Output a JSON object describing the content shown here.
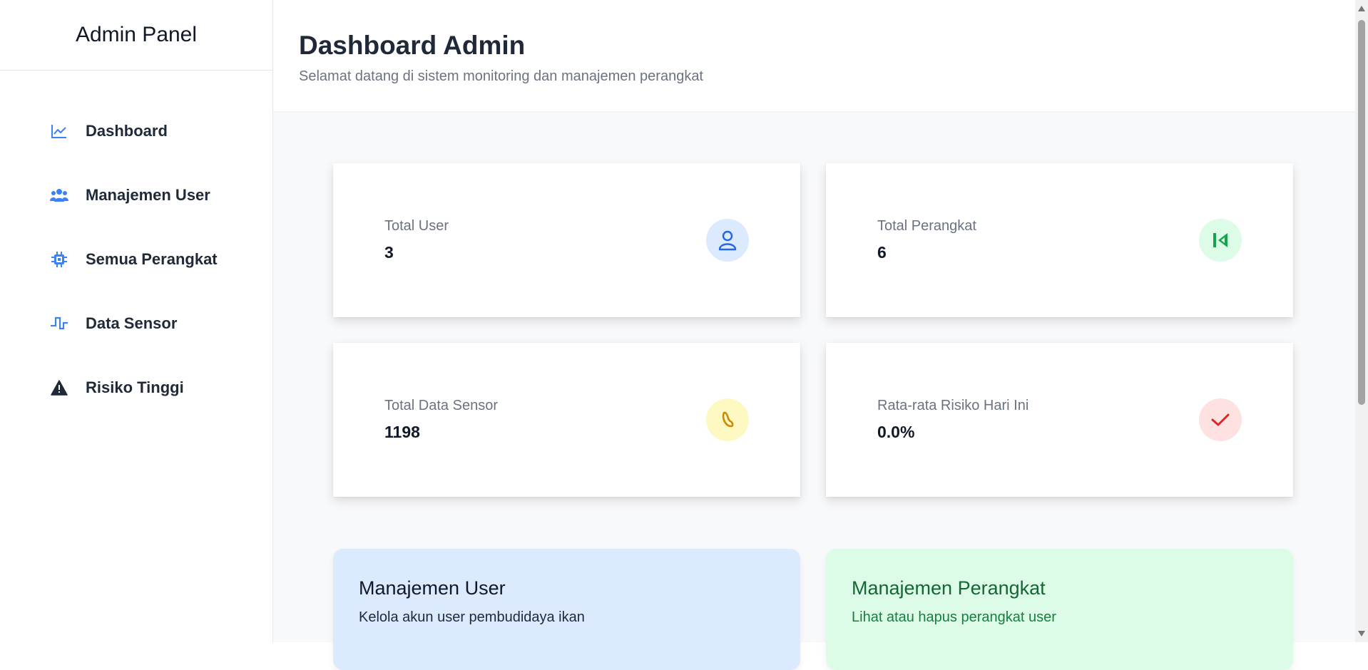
{
  "sidebar": {
    "title": "Admin Panel",
    "items": [
      {
        "label": "Dashboard",
        "icon": "chart-line-icon"
      },
      {
        "label": "Manajemen User",
        "icon": "users-icon"
      },
      {
        "label": "Semua Perangkat",
        "icon": "microchip-icon"
      },
      {
        "label": "Data Sensor",
        "icon": "wave-square-icon"
      },
      {
        "label": "Risiko Tinggi",
        "icon": "warning-triangle-icon"
      }
    ]
  },
  "header": {
    "title": "Dashboard Admin",
    "subtitle": "Selamat datang di sistem monitoring dan manajemen perangkat"
  },
  "stats": [
    {
      "label": "Total User",
      "value": "3",
      "icon": "user-icon",
      "icon_color": "#2563eb",
      "icon_bg": "#dbeafe"
    },
    {
      "label": "Total Perangkat",
      "value": "6",
      "icon": "device-icon",
      "icon_color": "#16a34a",
      "icon_bg": "#dcfce7"
    },
    {
      "label": "Total Data Sensor",
      "value": "1198",
      "icon": "sensor-icon",
      "icon_color": "#ca8a04",
      "icon_bg": "#fef9c3"
    },
    {
      "label": "Rata-rata Risiko Hari Ini",
      "value": "0.0%",
      "icon": "check-icon",
      "icon_color": "#dc2626",
      "icon_bg": "#fee2e2"
    }
  ],
  "actions": [
    {
      "title": "Manajemen User",
      "desc": "Kelola akun user pembudidaya ikan",
      "bg": "#dbeafe",
      "title_color": "#111827",
      "desc_color": "#1f2937"
    },
    {
      "title": "Manajemen Perangkat",
      "desc": "Lihat atau hapus perangkat user",
      "bg": "#dcfce7",
      "title_color": "#166534",
      "desc_color": "#15803d"
    }
  ],
  "colors": {
    "accent": "#3b82f6",
    "text_dark": "#1f2937",
    "text_muted": "#6b7280"
  }
}
